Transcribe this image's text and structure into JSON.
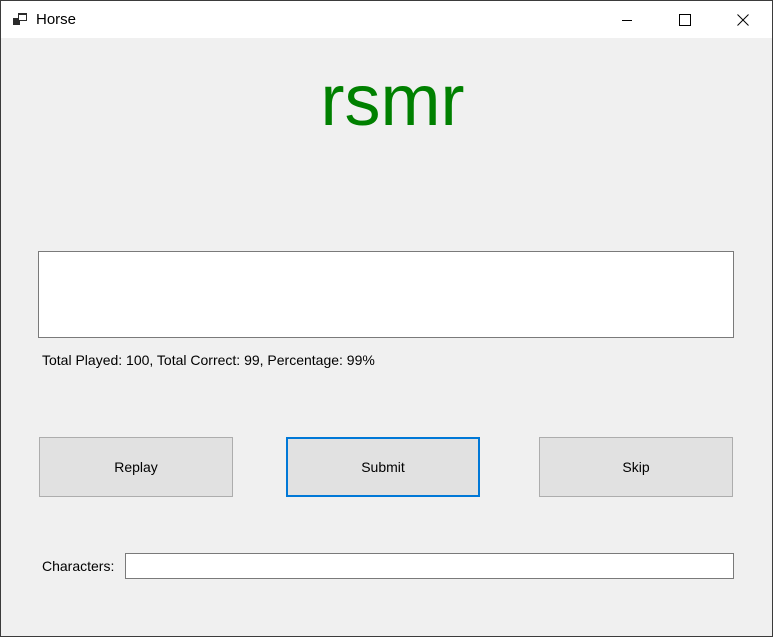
{
  "window": {
    "title": "Horse",
    "icon": "app-window-icon",
    "controls": [
      "minimize-icon",
      "maximize-icon",
      "close-icon"
    ]
  },
  "display": {
    "word": "rsmr",
    "word_color": "#008000"
  },
  "answer_box": {
    "value": ""
  },
  "stats": {
    "text": "Total Played: 100, Total Correct: 99, Percentage: 99%"
  },
  "buttons": {
    "replay": "Replay",
    "submit": "Submit",
    "skip": "Skip"
  },
  "characters": {
    "label": "Characters:",
    "value": ""
  },
  "colors": {
    "focus_accent": "#0078d7",
    "background": "#f0f0f0"
  }
}
